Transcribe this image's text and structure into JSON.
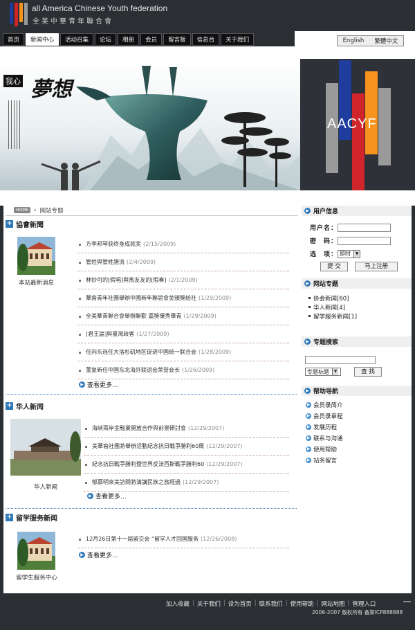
{
  "header": {
    "title_en": "all America Chinese Youth federation",
    "title_cn": "全美中華青年聯合會",
    "logo_colors": [
      "#1f3d9e",
      "#d0252a",
      "#f7931e",
      "#9a9a9a"
    ]
  },
  "nav": {
    "items": [
      {
        "label": "首页"
      },
      {
        "label": "新闻中心"
      },
      {
        "label": "活动召集"
      },
      {
        "label": "论坛"
      },
      {
        "label": "相册"
      },
      {
        "label": "会员"
      },
      {
        "label": "留言板"
      },
      {
        "label": "信息台"
      },
      {
        "label": "关于我们"
      }
    ],
    "active_index": 1
  },
  "lang": {
    "english": "English",
    "traditional": "繁體中文"
  },
  "banner": {
    "badge": "我心",
    "slogan": "夢想",
    "brand_text": "AACYF"
  },
  "breadcrumb": {
    "home": "HOME",
    "current": "网站专题"
  },
  "sections": {
    "association_news": {
      "title": "協會新聞",
      "caption": "本站最新消息",
      "items": [
        {
          "title": "方李邦琴获终身成就奖",
          "date": "(2/15/2009)"
        },
        {
          "title": "管姓與管姓譜流",
          "date": "(2/4/2009)"
        },
        {
          "title": "林妙可的[假唱]與馬友友的[假奏]",
          "date": "(2/1/2009)"
        },
        {
          "title": "華裔青年社團舉辦中國新年聯誼會並頒獎給社",
          "date": "(1/29/2009)"
        },
        {
          "title": "全美華青聯合會舉辦聯歡 嘉獎優秀華青",
          "date": "(1/29/2009)"
        },
        {
          "title": "[君王論]與臺灣政客",
          "date": "(1/27/2009)"
        },
        {
          "title": "任向东连任大洛杉矶地区促进中国统一联合会",
          "date": "(1/28/2009)"
        },
        {
          "title": "董复新任中国东北海外联谊会荣誉会长",
          "date": "(1/26/2009)"
        }
      ],
      "more": "查看更多..."
    },
    "chinese_news": {
      "title": "华人新闻",
      "caption": "华人新闻",
      "items": [
        {
          "title": "海峽兩岸金融業開放合作與前景研討會",
          "date": "(12/29/2007)"
        },
        {
          "title": "美華裔社團將舉辦活動紀念抗日戰爭勝利60周",
          "date": "(12/29/2007)"
        },
        {
          "title": "紀念抗日戰爭勝利暨世界反法西斯戰爭勝利60",
          "date": "(12/29/2007)"
        },
        {
          "title": "郁慕明來美訪問將演講民族之旅經過",
          "date": "(12/29/2007)"
        }
      ],
      "more": "查看更多..."
    },
    "study_abroad_news": {
      "title": "留学服务新闻",
      "caption": "留学生服务中心",
      "items": [
        {
          "title": "12月26日第十一届留交会 “留学人才回国服务",
          "date": "(12/26/2008)"
        }
      ],
      "more": "查看更多..."
    }
  },
  "sidebar": {
    "user_info": {
      "title": "用户信息",
      "username_label": "用户名：",
      "password_label": "密　码：",
      "option_label": "选　项：",
      "option_value": "即时",
      "submit": "提 交",
      "register": "马上注册"
    },
    "topics": {
      "title": "网站专题",
      "items": [
        "协会新闻[60]",
        "华人新闻[4]",
        "留学服务新闻[1]"
      ]
    },
    "topic_search": {
      "title": "专题搜索",
      "select_value": "专题标题",
      "search_button": "查 找"
    },
    "help": {
      "title": "帮助导航",
      "items": [
        "会员录简介",
        "会员录章程",
        "发展历程",
        "联系与沟通",
        "使用帮助",
        "站务留言"
      ]
    }
  },
  "footer": {
    "links": [
      "加入收藏",
      "关于我们",
      "设为首页",
      "联系我们",
      "使用帮助",
      "网站地图",
      "管理入口"
    ],
    "copyright": "2006-2007 版权所有 备案ICP888888"
  }
}
